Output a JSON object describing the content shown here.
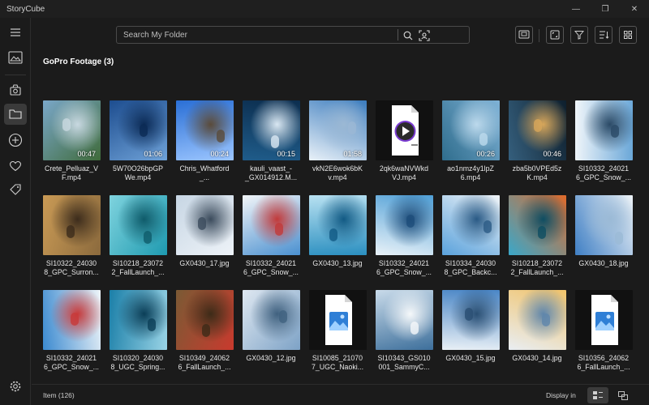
{
  "app": {
    "title": "StoryCube"
  },
  "window_controls": {
    "minimize": "—",
    "maximize": "❐",
    "close": "✕"
  },
  "search": {
    "placeholder": "Search My Folder",
    "value": ""
  },
  "section": {
    "title": "GoPro Footage (3)"
  },
  "status": {
    "item_count": "Item (126)",
    "display_in": "Display in"
  },
  "colors": {
    "background": "#1b1b1b",
    "accent": "#ffffff",
    "border": "#4a4a4a"
  },
  "sidebar_icons": [
    "menu-icon",
    "image-icon",
    "camera-story-icon",
    "folder-icon",
    "add-icon",
    "heart-icon",
    "tag-icon",
    "settings-icon"
  ],
  "toolbar_icons": [
    "screen-capture-icon",
    "fit-view-icon",
    "filter-icon",
    "sort-icon",
    "grid-view-icon"
  ],
  "items": [
    {
      "label": "Crete_Pelluaz_V\nF.mp4",
      "duration": "00:47",
      "kind": "video",
      "palette": [
        "#7aa7c9",
        "#3f6b3a",
        "#c8d8e0"
      ]
    },
    {
      "label": "5W70O26bpGP\nWe.mp4",
      "duration": "01:06",
      "kind": "video",
      "palette": [
        "#1d4d8f",
        "#6fa2d8",
        "#0b2a55"
      ]
    },
    {
      "label": "Chris_Whatford\n_...",
      "duration": "00:24",
      "kind": "video",
      "palette": [
        "#2a6fd6",
        "#9cc6ff",
        "#5a4b3a"
      ]
    },
    {
      "label": "kauli_vaast_-\n_GX014912.M...",
      "duration": "00:15",
      "kind": "video",
      "palette": [
        "#0c2e4f",
        "#1f5c8a",
        "#d9e7f2"
      ]
    },
    {
      "label": "vkN2E6wok6bK\nv.mp4",
      "duration": "01:58",
      "kind": "video",
      "palette": [
        "#3a7bbd",
        "#e9f1f8",
        "#9bb8d4"
      ]
    },
    {
      "label": "2qk6waNVWkd\nVJ.mp4",
      "duration": "",
      "kind": "video-file",
      "palette": []
    },
    {
      "label": "ao1nmz4y1lpZ\n6.mp4",
      "duration": "00:26",
      "kind": "video",
      "palette": [
        "#7fb2d6",
        "#2f6d8d",
        "#bcd9ec"
      ]
    },
    {
      "label": "zba5b0VPEd5z\nK.mp4",
      "duration": "00:46",
      "kind": "video",
      "palette": [
        "#0e1f2d",
        "#355f7d",
        "#d7a65a"
      ]
    },
    {
      "label": "SI10332_24021\n6_GPC_Snow_...",
      "duration": "",
      "kind": "image",
      "palette": [
        "#6aa7d8",
        "#f1f6fa",
        "#2b4a66"
      ]
    },
    {
      "label": "SI10322_24030\n8_GPC_Surron...",
      "duration": "",
      "kind": "image",
      "palette": [
        "#8b6a3d",
        "#c99a55",
        "#3c2c1c"
      ]
    },
    {
      "label": "SI10218_23072\n2_FallLaunch_...",
      "duration": "",
      "kind": "image",
      "palette": [
        "#1e9ab0",
        "#7fd3de",
        "#0f5b6a"
      ]
    },
    {
      "label": "GX0430_17.jpg",
      "duration": "",
      "kind": "image",
      "palette": [
        "#eef3f8",
        "#c7d6e4",
        "#3b4b5c"
      ]
    },
    {
      "label": "SI10332_24021\n6_GPC_Snow_...",
      "duration": "",
      "kind": "image",
      "palette": [
        "#4a90d0",
        "#f2f5f8",
        "#c23a3a"
      ]
    },
    {
      "label": "GX0430_13.jpg",
      "duration": "",
      "kind": "image",
      "palette": [
        "#2b8fc0",
        "#b8e1f1",
        "#125a84"
      ]
    },
    {
      "label": "SI10332_24021\n6_GPC_Snow_...",
      "duration": "",
      "kind": "image",
      "palette": [
        "#e9f2f8",
        "#4f9fd6",
        "#1e4d7a"
      ]
    },
    {
      "label": "SI10334_24030\n8_GPC_Backc...",
      "duration": "",
      "kind": "image",
      "palette": [
        "#5aa2dc",
        "#f0f4f7",
        "#2a5a85"
      ]
    },
    {
      "label": "SI10218_23072\n2_FallLaunch_...",
      "duration": "",
      "kind": "image",
      "palette": [
        "#3aa7c9",
        "#e06a2a",
        "#0e4d62"
      ]
    },
    {
      "label": "GX0430_18.jpg",
      "duration": "",
      "kind": "image",
      "palette": [
        "#3f7fc4",
        "#eef3f7",
        "#9bbad6"
      ]
    },
    {
      "label": "SI10332_24021\n6_GPC_Snow_...",
      "duration": "",
      "kind": "image",
      "palette": [
        "#3b8ad0",
        "#eef4f8",
        "#c83a3a"
      ]
    },
    {
      "label": "SI10320_24030\n8_UGC_Spring...",
      "duration": "",
      "kind": "image",
      "palette": [
        "#1b7fa8",
        "#9ad4e6",
        "#0b3e57"
      ]
    },
    {
      "label": "SI10349_24062\n6_FallLaunch_...",
      "duration": "",
      "kind": "image",
      "palette": [
        "#7a5a34",
        "#c93a2e",
        "#3d2b18"
      ]
    },
    {
      "label": "GX0430_12.jpg",
      "duration": "",
      "kind": "image",
      "palette": [
        "#dfe8f1",
        "#7da2c6",
        "#40617f"
      ]
    },
    {
      "label": "SI10085_21070\n7_UGC_Naoki...",
      "duration": "",
      "kind": "image-file",
      "palette": []
    },
    {
      "label": "SI10343_GS010\n001_SammyC...",
      "duration": "",
      "kind": "image",
      "palette": [
        "#c9dbea",
        "#3d6f9b",
        "#f5f8fa"
      ]
    },
    {
      "label": "GX0430_15.jpg",
      "duration": "",
      "kind": "image",
      "palette": [
        "#4a86c6",
        "#e9f0f6",
        "#2a4f73"
      ]
    },
    {
      "label": "GX0430_14.jpg",
      "duration": "",
      "kind": "image",
      "palette": [
        "#f1c36a",
        "#e9eef3",
        "#5f86ab"
      ]
    },
    {
      "label": "SI10356_24062\n6_FallLaunch_...",
      "duration": "",
      "kind": "image-file",
      "palette": []
    }
  ]
}
